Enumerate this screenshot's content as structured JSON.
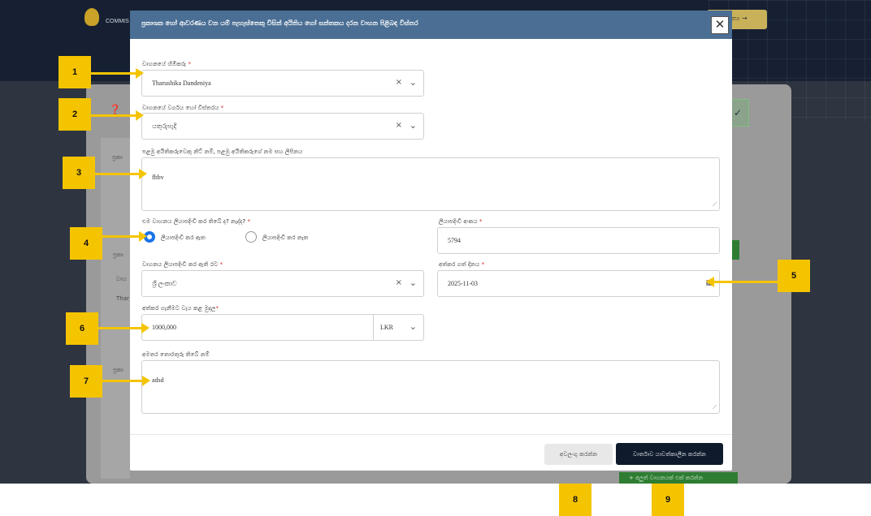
{
  "background": {
    "logo_text": "COMMIS",
    "next_button": "ත්‍ය →",
    "side_texts": [
      "ප්‍රකා",
      "ප්‍රකා",
      "වාහ",
      "Thar",
      "ප්‍රකා"
    ],
    "add_button": "+ අලුත් වාහනයක් එක් කරන්න"
  },
  "modal": {
    "title": "ප්‍රකාශක හෝ ආවරණය වන යම් පැහැස්තෙකු විසින් අයිතිය හෝ සන්තකය දරන වාහන පිළිබඳ විස්තර",
    "close_icon": "✕",
    "owner": {
      "label": "වාහනයේ හිමිකරු",
      "value": "Tharushika  Dandeniya"
    },
    "vehicle_type": {
      "label": "වාහනයේ වර්ගය හෝ විස්තරය",
      "value": "යතුරුපැදි"
    },
    "first_owner": {
      "label": "පළමු අයිතිකරුවෙකු නිට් නම්, පළමු අයිතිකරුගේ නම සහ ලිපිනය",
      "value": "fbbv"
    },
    "registered": {
      "label": "එම වාහනය ලියාපදිංචි කර තිබේ ද? නැද්ද?",
      "option_yes": "ලියාපදිංචි කර ඇත",
      "option_no": "ලියාපදිංචි කර නැත",
      "selected": "yes"
    },
    "reg_number": {
      "label": "ලියාපදිංචි අංකය",
      "value": "5794"
    },
    "reg_country": {
      "label": "වාහනය ලියාපදිංචි කර ඇති රට",
      "value": "ශ්‍රී ලංකාව"
    },
    "acquired_date": {
      "label": "අත්කර ගත් දිනය",
      "value": "2025-11-03"
    },
    "price": {
      "label": "අත්කර ගැනීමට වැය කළ මුදල",
      "value": "1000,000",
      "currency": "LKR"
    },
    "notes": {
      "label": "අමතර තොරතුරු තිබේ නම්",
      "value": "adsd"
    },
    "cancel_button": "අවලංගු කරන්න",
    "submit_button": "වාර්තාව යාවත්කාලීන කරන්න"
  },
  "annotations": [
    "1",
    "2",
    "3",
    "4",
    "5",
    "6",
    "7",
    "8",
    "9"
  ]
}
